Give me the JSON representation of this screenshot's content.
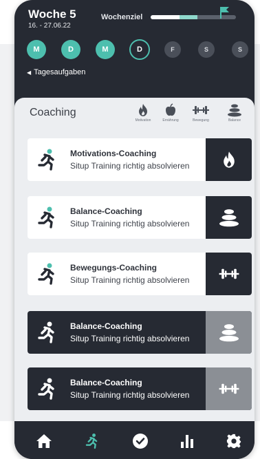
{
  "header": {
    "week_title": "Woche 5",
    "week_range": "16. - 27.06.22",
    "goal_label": "Wochenziel",
    "goal_progress": 0.55,
    "tasks_link": "Tagesaufgaben",
    "days": [
      {
        "label": "M",
        "state": "done"
      },
      {
        "label": "D",
        "state": "done"
      },
      {
        "label": "M",
        "state": "done"
      },
      {
        "label": "D",
        "state": "current"
      },
      {
        "label": "F",
        "state": "upcoming"
      },
      {
        "label": "S",
        "state": "upcoming"
      },
      {
        "label": "S",
        "state": "upcoming"
      }
    ]
  },
  "coaching": {
    "title": "Coaching",
    "categories": [
      {
        "label": "Motivation",
        "icon": "flame-icon"
      },
      {
        "label": "Ernährung",
        "icon": "apple-icon"
      },
      {
        "label": "Bewegung",
        "icon": "dumbbell-icon"
      },
      {
        "label": "Balance",
        "icon": "stones-icon"
      }
    ],
    "cards": [
      {
        "title": "Motivations-Coaching",
        "subtitle": "Situp Training richtig absolvieren",
        "icon": "flame-icon",
        "style": "light"
      },
      {
        "title": "Balance-Coaching",
        "subtitle": "Situp Training richtig absolvieren",
        "icon": "stones-icon",
        "style": "light"
      },
      {
        "title": "Bewegungs-Coaching",
        "subtitle": "Situp Training richtig absolvieren",
        "icon": "dumbbell-icon",
        "style": "light"
      },
      {
        "title": "Balance-Coaching",
        "subtitle": "Situp Training richtig absolvieren",
        "icon": "stones-icon",
        "style": "dark"
      },
      {
        "title": "Balance-Coaching",
        "subtitle": "Situp Training richtig absolvieren",
        "icon": "dumbbell-icon",
        "style": "dark"
      }
    ]
  },
  "tabbar": {
    "items": [
      {
        "icon": "home-icon",
        "active": false
      },
      {
        "icon": "runner-icon",
        "active": true
      },
      {
        "icon": "check-circle-icon",
        "active": false
      },
      {
        "icon": "bar-chart-icon",
        "active": false
      },
      {
        "icon": "gear-icon",
        "active": false
      }
    ]
  },
  "colors": {
    "accent": "#4dbfae",
    "dark": "#262a33",
    "sheet": "#eceef1"
  }
}
